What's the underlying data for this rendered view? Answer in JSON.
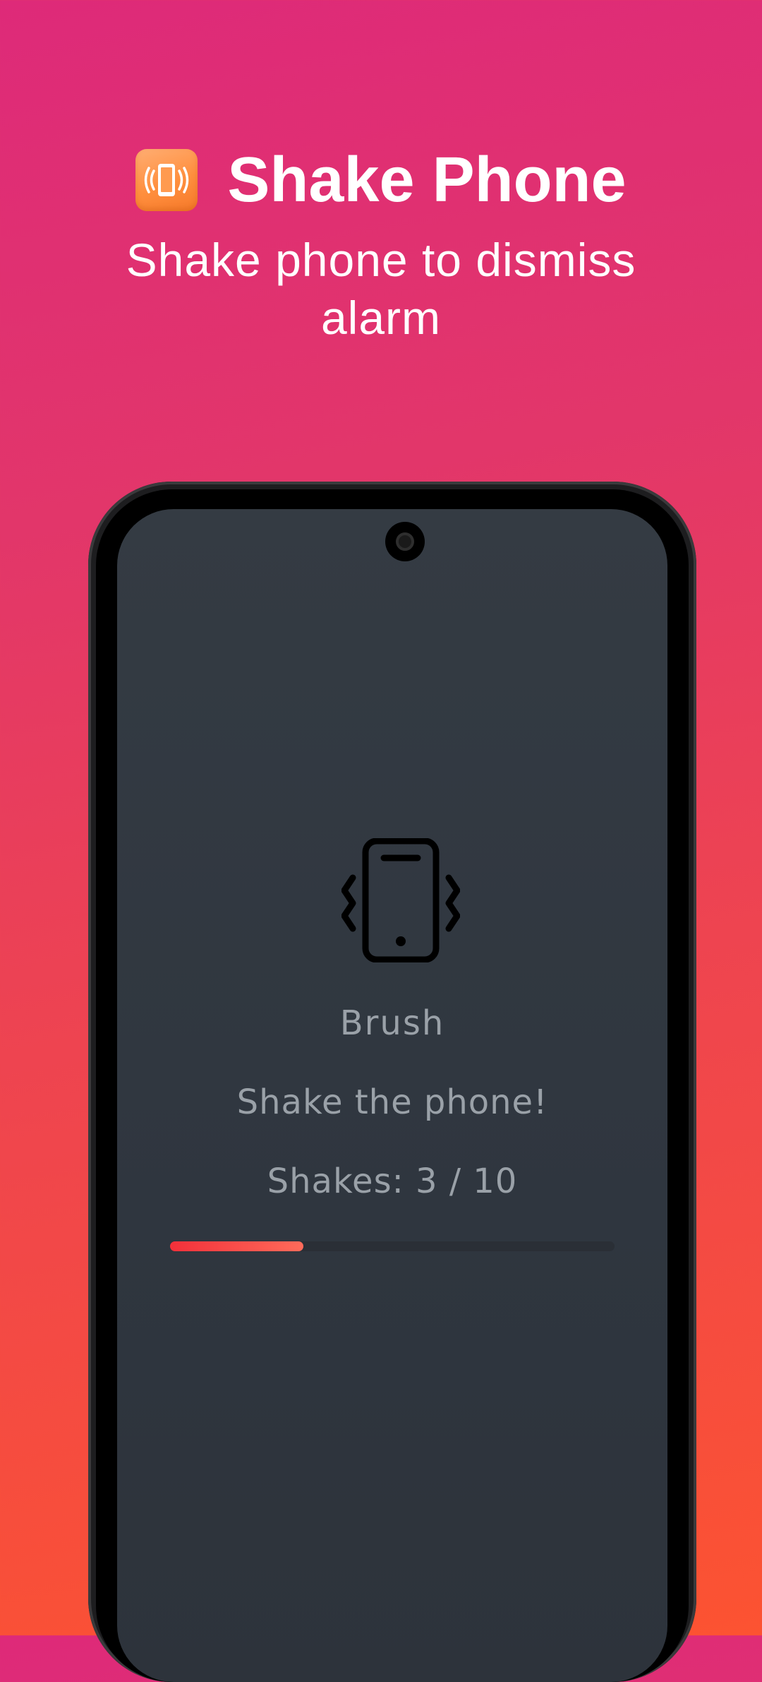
{
  "header": {
    "title": "Shake Phone",
    "subtitle": "Shake phone to dismiss alarm",
    "icon": "vibrating-phone-icon"
  },
  "screen": {
    "icon": "shake-phone-icon",
    "mode_label": "Brush",
    "instruction": "Shake the phone!",
    "counter_text": "Shakes: 3 / 10",
    "progress": {
      "current": 3,
      "total": 10
    }
  },
  "colors": {
    "background_top": "#de2a79",
    "background_bottom": "#fc5331",
    "screen_bg": "#343b43",
    "progress_fill": "#f3303a",
    "progress_track": "#2a2f36",
    "text_muted": "#9aa1a8",
    "icon_orange": "#ff8f3e"
  }
}
